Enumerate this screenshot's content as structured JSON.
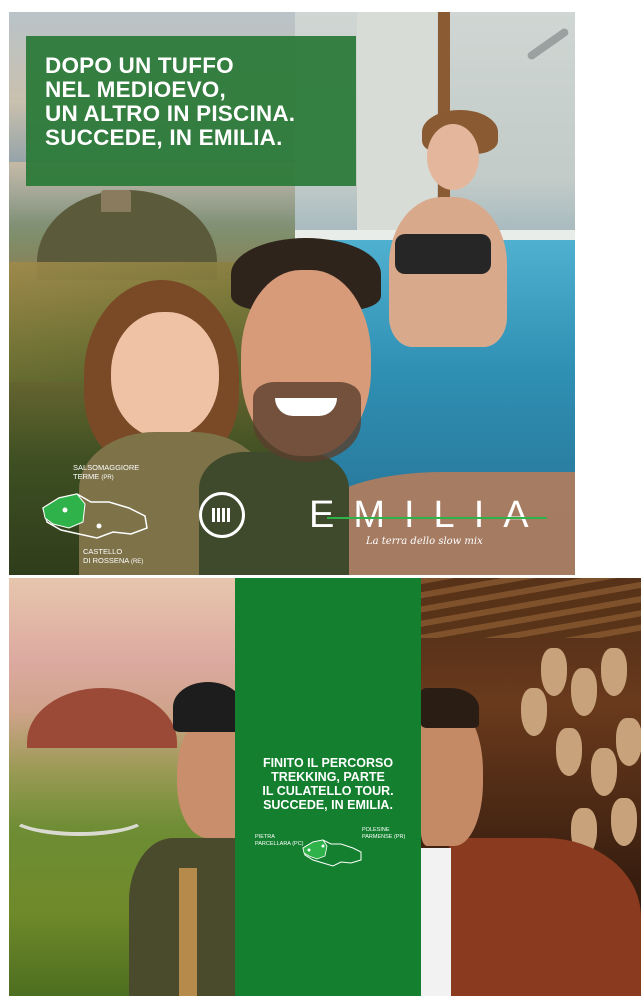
{
  "poster1": {
    "headline_lines": [
      "DOPO UN TUFFO",
      "NEL MEDIOEVO,",
      "UN ALTRO IN PISCINA.",
      "SUCCEDE, IN EMILIA."
    ],
    "logo": "EMILIA",
    "tagline": "La terra dello slow mix",
    "location1": {
      "line1": "SALSOMAGGIORE",
      "line2": "TERME",
      "province": "(PR)"
    },
    "location2": {
      "line1": "CASTELLO",
      "line2": "DI ROSSENA",
      "province": "(RE)"
    },
    "badge_icon": "castle-badge-icon",
    "colors": {
      "brand_green": "#2c7a3a",
      "logo_line": "#2fb24a"
    }
  },
  "poster2": {
    "headline_lines": [
      "FINITO IL PERCORSO",
      "TREKKING, PARTE",
      "IL CULATELLO TOUR.",
      "SUCCEDE, IN EMILIA."
    ],
    "location1": {
      "line1": "PIETRA",
      "line2": "PARCELLARA",
      "province": "(PC)"
    },
    "location2": {
      "line1": "POLESINE",
      "line2": "PARMENSE",
      "province": "(PR)"
    },
    "colors": {
      "panel_green": "#14802f"
    }
  }
}
